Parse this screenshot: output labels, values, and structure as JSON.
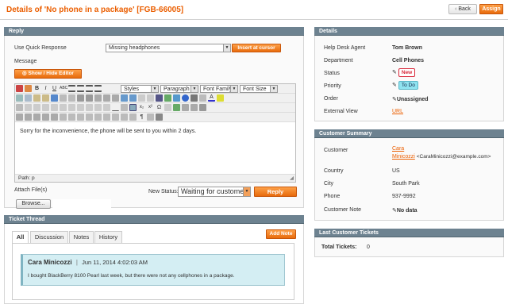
{
  "header": {
    "title": "Details of 'No phone in a package' [FGB-66005]",
    "back_label": "Back",
    "assign_label": "Assign"
  },
  "reply": {
    "panel_title": "Reply",
    "quick_response_label": "Use Quick Response",
    "quick_response_value": "Missing headphones",
    "insert_label": "Insert at cursor",
    "message_label": "Message",
    "editor_toggle_label": "Show / Hide Editor",
    "toolbar": {
      "styles": "Styles",
      "paragraph": "Paragraph",
      "font_family": "Font Family",
      "font_size": "Font Size"
    },
    "body_text": "Sorry for the inconvenience, the phone will be sent to you within 2 days.",
    "path_text": "Path: p",
    "attach_label": "Attach File(s)",
    "browse_label": "Browse...",
    "new_status_label": "New Status:",
    "new_status_value": "Waiting for customer",
    "reply_button": "Reply"
  },
  "thread": {
    "panel_title": "Ticket Thread",
    "add_note": "Add Note",
    "tabs": [
      "All",
      "Discussion",
      "Notes",
      "History"
    ],
    "message": {
      "author": "Cara Minicozzi",
      "separator": "|",
      "date": "Jun 11, 2014 4:02:03 AM",
      "text": "I bought BlackBerry 8100 Pearl last week, but there were not any cellphones in a package."
    }
  },
  "details": {
    "panel_title": "Details",
    "rows": [
      {
        "label": "Help Desk Agent",
        "value": "Tom Brown"
      },
      {
        "label": "Department",
        "value": "Cell Phones"
      },
      {
        "label": "Status",
        "value": "New"
      },
      {
        "label": "Priority",
        "value": "To Do"
      },
      {
        "label": "Order",
        "value": "Unassigned"
      },
      {
        "label": "External View",
        "value": "URL"
      }
    ]
  },
  "customer": {
    "panel_title": "Customer Summary",
    "rows": [
      {
        "label": "Customer",
        "value": "Cara",
        "value2": "Minicozzi",
        "email": "<CaraMinicozzi@example.com>"
      },
      {
        "label": "Country",
        "value": "US"
      },
      {
        "label": "City",
        "value": "South Park"
      },
      {
        "label": "Phone",
        "value": "937-9992"
      },
      {
        "label": "Customer Note",
        "value": "No data"
      }
    ]
  },
  "last_tickets": {
    "panel_title": "Last Customer Tickets",
    "total_label": "Total Tickets:",
    "total_value": "0"
  },
  "colors": {
    "accent": "#eb5e00",
    "panel_header": "#6d8290",
    "status_new": "#d9283a",
    "priority_todo": "#8fe3f0",
    "message_bg": "#d4eef3"
  }
}
